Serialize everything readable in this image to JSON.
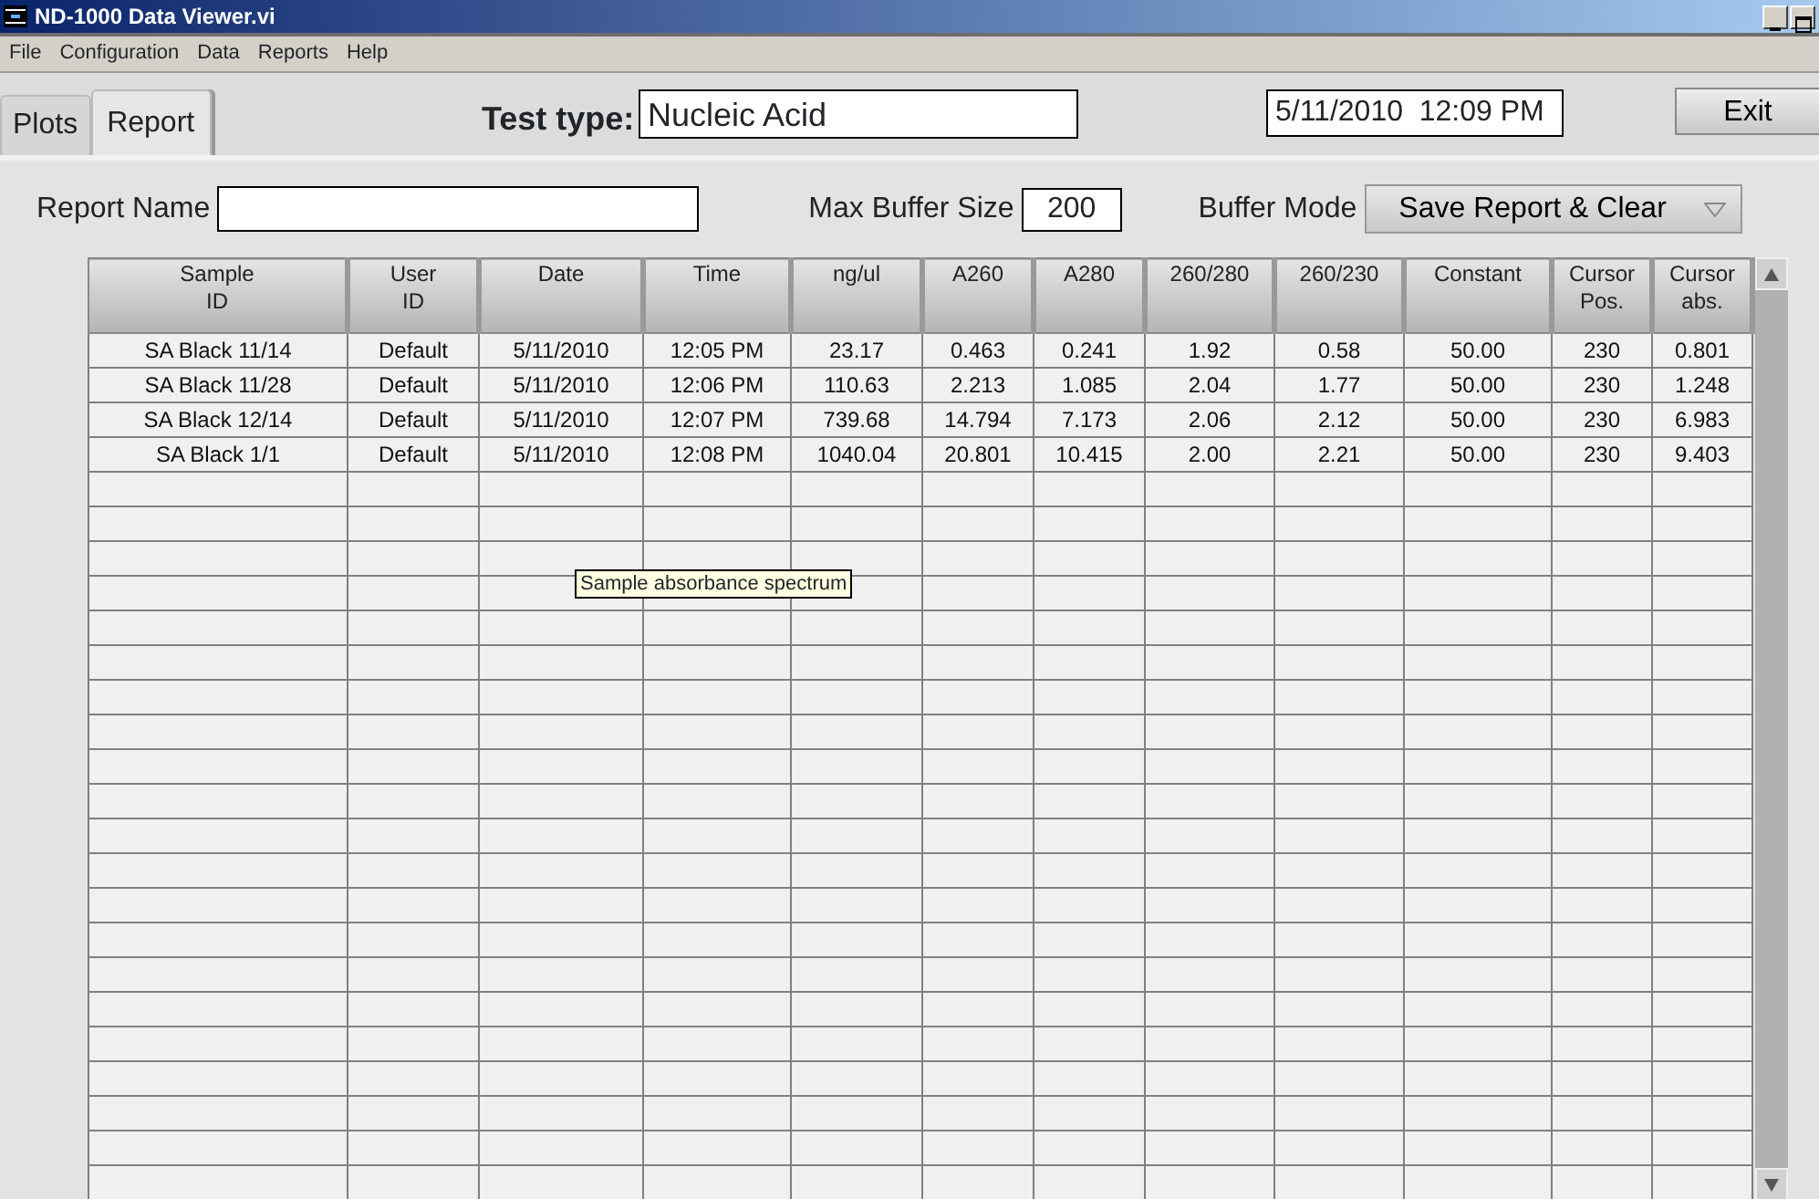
{
  "window": {
    "title": "ND-1000 Data Viewer.vi"
  },
  "menu": [
    "File",
    "Configuration",
    "Data",
    "Reports",
    "Help"
  ],
  "tabs": [
    {
      "label": "Plots",
      "selected": false
    },
    {
      "label": "Report",
      "selected": true
    }
  ],
  "test_type": {
    "label": "Test type:",
    "value": "Nucleic Acid"
  },
  "datetime": "5/11/2010  12:09 PM",
  "exit_button": "Exit",
  "report_name": {
    "label": "Report Name"
  },
  "max_buffer": {
    "label": "Max Buffer Size",
    "value": "200"
  },
  "buffer_mode": {
    "label": "Buffer Mode",
    "value": "Save Report & Clear"
  },
  "table": {
    "columns": [
      "Sample\nID",
      "User\nID",
      "Date",
      "Time",
      "ng/ul",
      "A260",
      "A280",
      "260/280",
      "260/230",
      "Constant",
      "Cursor\nPos.",
      "Cursor\nabs."
    ],
    "rows": [
      [
        "SA Black 11/14",
        "Default",
        "5/11/2010",
        "12:05 PM",
        "23.17",
        "0.463",
        "0.241",
        "1.92",
        "0.58",
        "50.00",
        "230",
        "0.801"
      ],
      [
        "SA Black 11/28",
        "Default",
        "5/11/2010",
        "12:06 PM",
        "110.63",
        "2.213",
        "1.085",
        "2.04",
        "1.77",
        "50.00",
        "230",
        "1.248"
      ],
      [
        "SA Black 12/14",
        "Default",
        "5/11/2010",
        "12:07 PM",
        "739.68",
        "14.794",
        "7.173",
        "2.06",
        "2.12",
        "50.00",
        "230",
        "6.983"
      ],
      [
        "SA Black 1/1",
        "Default",
        "5/11/2010",
        "12:08 PM",
        "1040.04",
        "20.801",
        "10.415",
        "2.00",
        "2.21",
        "50.00",
        "230",
        "9.403"
      ]
    ]
  },
  "tooltip": "Sample absorbance spectrum"
}
